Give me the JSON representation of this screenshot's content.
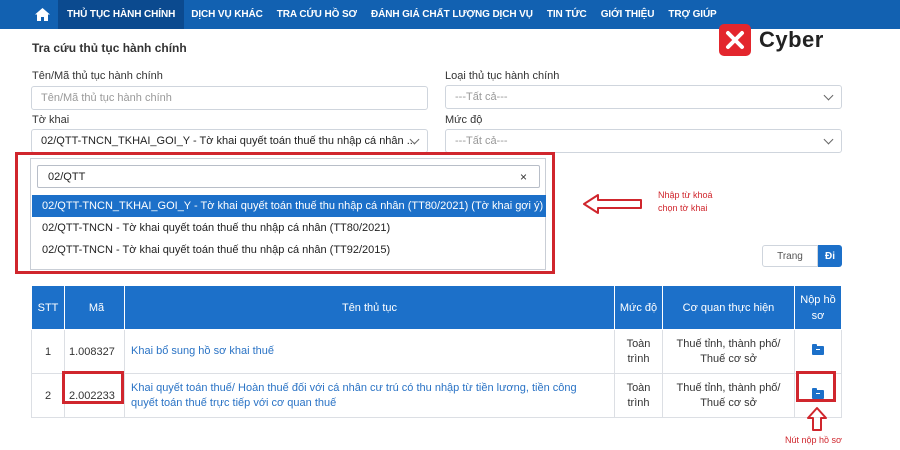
{
  "nav": {
    "items": [
      "THỦ TỤC HÀNH CHÍNH",
      "DỊCH VỤ KHÁC",
      "TRA CỨU HỒ SƠ",
      "ĐÁNH GIÁ CHẤT LƯỢNG DỊCH VỤ",
      "TIN TỨC",
      "GIỚI THIỆU",
      "TRỢ GIÚP"
    ],
    "active_index": 0
  },
  "logo": {
    "text": "Cyber"
  },
  "page": {
    "title": "Tra cứu thủ tục hành chính"
  },
  "form": {
    "name_label": "Tên/Mã thủ tục hành chính",
    "name_placeholder": "Tên/Mã thủ tục hành chính",
    "type_label": "Loại thủ tục hành chính",
    "type_value": "---Tất cả---",
    "declaration_label": "Tờ khai",
    "declaration_value": "02/QTT-TNCN_TKHAI_GOI_Y - Tờ khai quyết toán thuế thu nhập cá nhân ...",
    "level_label": "Mức độ",
    "level_value": "---Tất cả---"
  },
  "dropdown": {
    "search_value": "02/QTT",
    "clear": "×",
    "options": [
      "02/QTT-TNCN_TKHAI_GOI_Y - Tờ khai quyết toán thuế thu nhập cá nhân (TT80/2021) (Tờ khai gợi ý)",
      "02/QTT-TNCN - Tờ khai quyết toán thuế thu nhập cá nhân (TT80/2021)",
      "02/QTT-TNCN - Tờ khai quyết toán thuế thu nhập cá nhân (TT92/2015)"
    ],
    "selected_index": 0
  },
  "annotations": {
    "keyword_line1": "Nhập từ khoá",
    "keyword_line2": "chọn tờ khai",
    "submit": "Nút nộp hồ sơ"
  },
  "pagination": {
    "page_placeholder": "Trang",
    "go_label": "Đi"
  },
  "table": {
    "headers": [
      "STT",
      "Mã",
      "Tên thủ tục",
      "Mức độ",
      "Cơ quan thực hiện",
      "Nộp hồ sơ"
    ],
    "rows": [
      {
        "stt": "1",
        "code": "1.008327",
        "name_line1": "Khai bổ sung hồ sơ khai thuế",
        "name_line2": "",
        "level_line1": "Toàn",
        "level_line2": "trình",
        "agency_line1": "Thuế tỉnh, thành phố/",
        "agency_line2": "Thuế cơ sở"
      },
      {
        "stt": "2",
        "code": "2.002233",
        "name_line1": "Khai quyết toán thuế/ Hoàn thuế đối với cá nhân cư trú có thu nhập từ tiền lương, tiền công",
        "name_line2": "quyết toán thuế trực tiếp với cơ quan thuế",
        "level_line1": "Toàn",
        "level_line2": "trình",
        "agency_line1": "Thuế tỉnh, thành phố/",
        "agency_line2": "Thuế cơ sở"
      }
    ]
  },
  "colors": {
    "nav_bg": "#1261b1",
    "accent": "#1c70c9",
    "highlight_red": "#d0262d"
  }
}
